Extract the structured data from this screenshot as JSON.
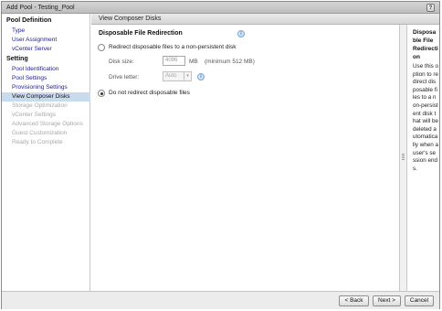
{
  "window": {
    "title": "Add Pool - Testing_Pool",
    "help_label": "?"
  },
  "sidebar": {
    "sections": [
      {
        "label": "Pool Definition",
        "items": [
          "Type",
          "User Assignment",
          "vCenter Server"
        ]
      },
      {
        "label": "Setting",
        "items": [
          "Pool Identification",
          "Pool Settings",
          "Provisioning Settings",
          "View Composer Disks",
          "Storage Optimization",
          "vCenter Settings",
          "Advanced Storage Options",
          "Guest Customization",
          "Ready to Complete"
        ]
      }
    ]
  },
  "panel": {
    "header": "View Composer Disks",
    "heading": "Disposable File Redirection",
    "info_icon": "info-icon",
    "option_redirect": "Redirect disposable files to a non-persistent disk",
    "disk_size_label": "Disk size:",
    "disk_size_value": "4096",
    "disk_size_unit": "MB",
    "disk_size_hint": "(minimum 512 MB)",
    "drive_letter_label": "Drive letter:",
    "drive_letter_value": "Auto",
    "option_no_redirect": "Do not redirect disposable files",
    "selected_option": "no_redirect"
  },
  "help": {
    "title": "Disposable File Redirection",
    "body": "Use this option to redirect disposable files to a non-persistent disk that will be deleted automatically when a user's session ends."
  },
  "footer": {
    "back": "< Back",
    "next": "Next >",
    "cancel": "Cancel"
  },
  "colors": {
    "link": "#1c1c8c",
    "selected_bg": "#c9dbef",
    "disabled": "#a8a8a8"
  }
}
